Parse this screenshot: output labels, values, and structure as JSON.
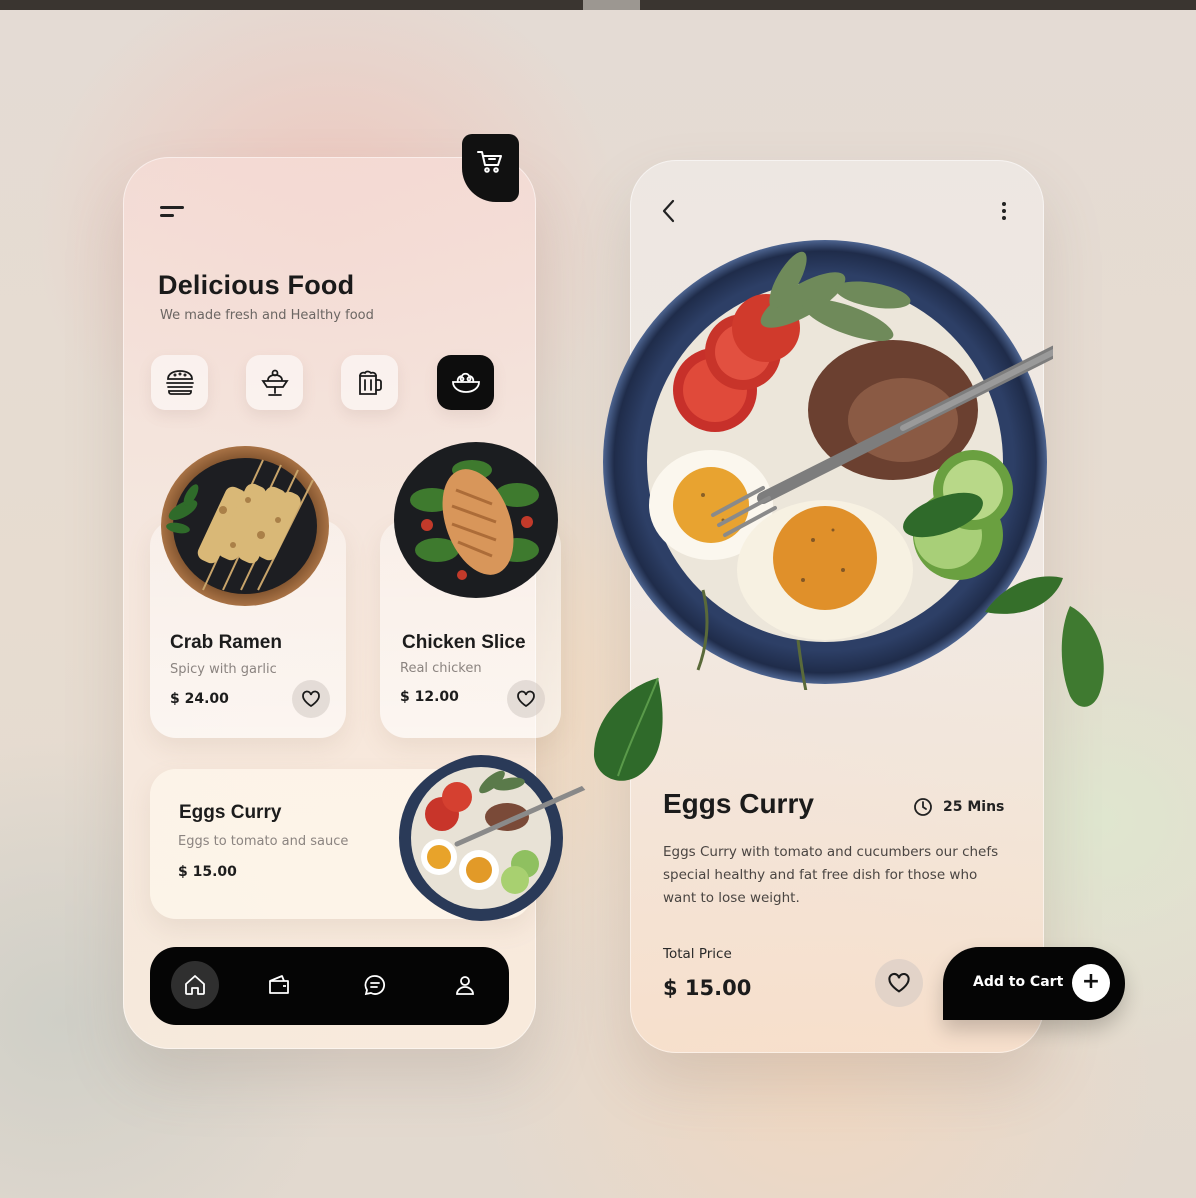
{
  "colors": {
    "accent": "#0d0d0d",
    "background": "#e6dbd2",
    "muted_text": "#8b8480"
  },
  "home": {
    "title": "Delicious Food",
    "subtitle": "We made fresh and Healthy food",
    "categories": [
      {
        "icon": "burger-icon",
        "active": false
      },
      {
        "icon": "dessert-icon",
        "active": false
      },
      {
        "icon": "beer-mug-icon",
        "active": false
      },
      {
        "icon": "salad-icon",
        "active": true
      }
    ],
    "items": [
      {
        "name": "Crab Ramen",
        "desc": "Spicy with garlic",
        "price": "$ 24.00"
      },
      {
        "name": "Chicken Slice",
        "desc": "Real chicken",
        "price": "$ 12.00"
      },
      {
        "name": "Eggs Curry",
        "desc": "Eggs to tomato and sauce",
        "price": "$ 15.00"
      }
    ],
    "nav": [
      "home-icon",
      "wallet-icon",
      "chat-icon",
      "user-icon"
    ]
  },
  "detail": {
    "title": "Eggs Curry",
    "time": "25 Mins",
    "description": "Eggs Curry with tomato and cucumbers our chefs special healthy and fat free dish for those who want to lose weight.",
    "total_label": "Total Price",
    "total_value": "$ 15.00",
    "add_to_cart": "Add to Cart",
    "plus": "+"
  }
}
